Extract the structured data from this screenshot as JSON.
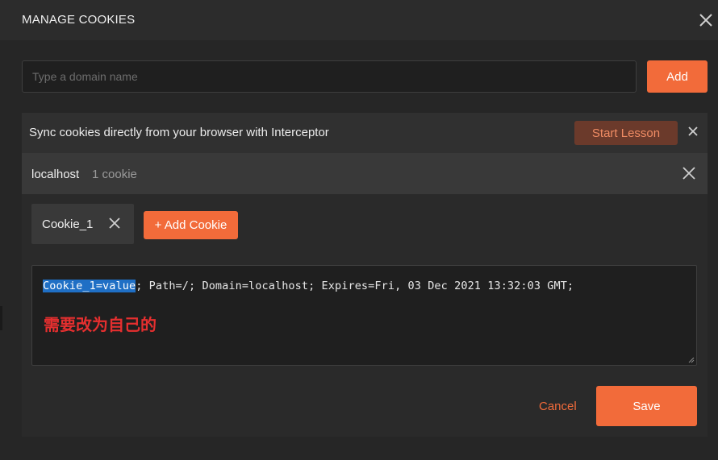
{
  "dialog": {
    "title": "MANAGE COOKIES",
    "close_icon": "close-icon"
  },
  "domain_form": {
    "placeholder": "Type a domain name",
    "value": "",
    "add_label": "Add"
  },
  "banner": {
    "text": "Sync cookies directly from your browser with Interceptor",
    "start_lesson_label": "Start Lesson"
  },
  "domain": {
    "name": "localhost",
    "count": "1 cookie",
    "cookies": [
      {
        "label": "Cookie_1"
      }
    ],
    "add_cookie_label": "+ Add Cookie"
  },
  "editor": {
    "selected": "Cookie_1=value",
    "rest": "; Path=/; Domain=localhost; Expires=Fri, 03 Dec 2021 13:32:03 GMT;",
    "annotation": "需要改为自己的"
  },
  "actions": {
    "cancel_label": "Cancel",
    "save_label": "Save"
  },
  "colors": {
    "accent": "#f26b3a",
    "background": "#262626",
    "annotation": "#e52f2f",
    "selection": "#1f6fc5"
  }
}
